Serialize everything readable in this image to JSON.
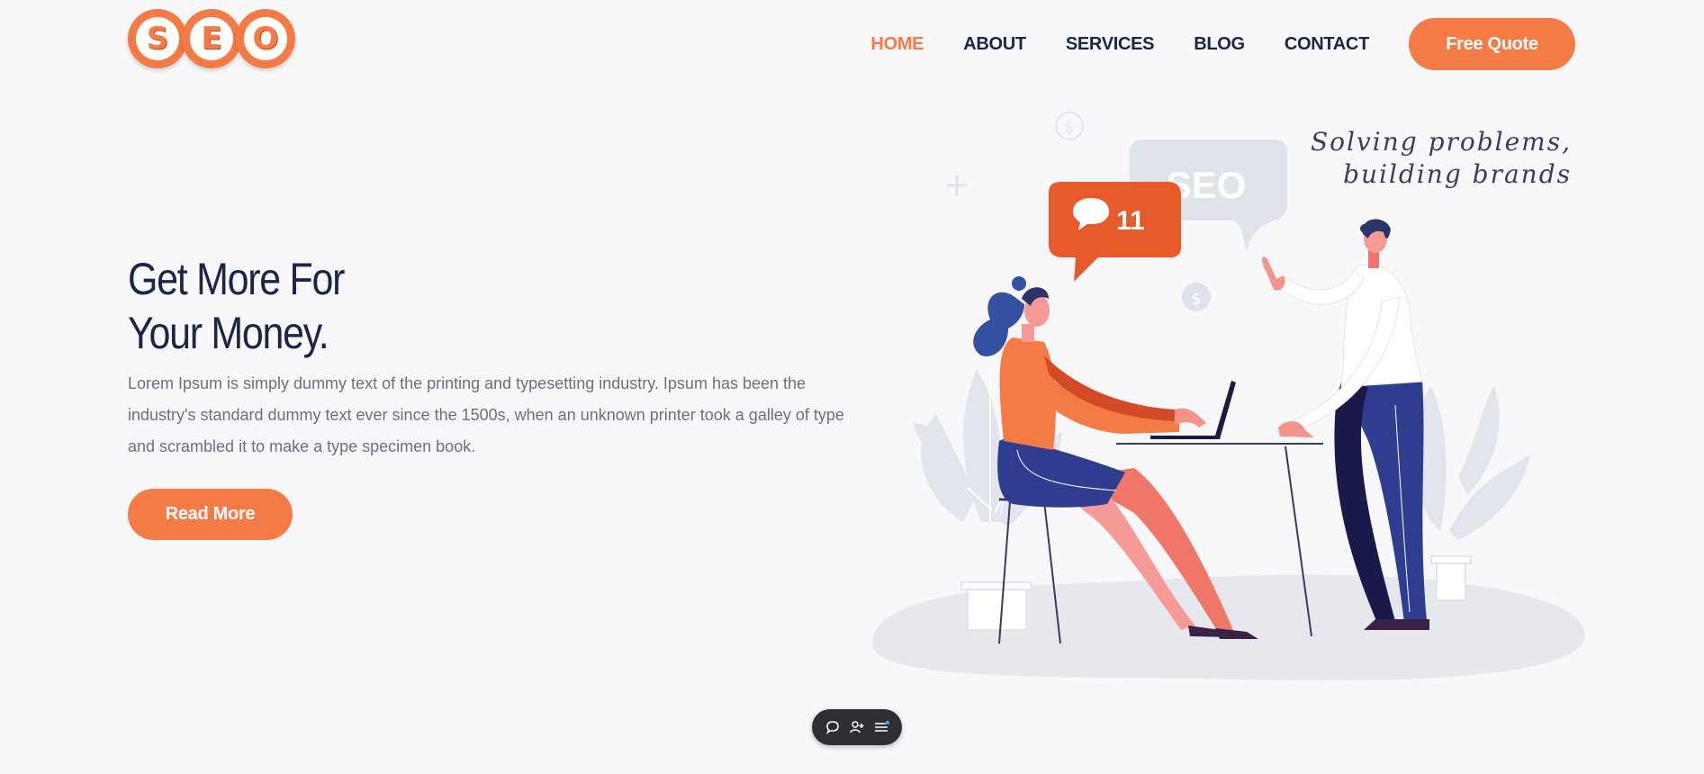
{
  "logo": {
    "letters": [
      "S",
      "E",
      "O"
    ]
  },
  "nav": {
    "items": [
      {
        "label": "HOME",
        "active": true
      },
      {
        "label": "ABOUT",
        "active": false
      },
      {
        "label": "SERVICES",
        "active": false
      },
      {
        "label": "BLOG",
        "active": false
      },
      {
        "label": "CONTACT",
        "active": false
      }
    ],
    "cta_label": "Free Quote"
  },
  "hero": {
    "title_line1": "Get More For",
    "title_line2": "Your Money.",
    "body": "Lorem Ipsum is simply dummy text of the printing and typesetting industry. Ipsum has been the industry's standard dummy text ever since the 1500s, when an unknown printer took a galley of type and scrambled it to make a type specimen book.",
    "button_label": "Read More"
  },
  "illustration": {
    "tagline_line1": "Solving problems,",
    "tagline_line2": "building brands",
    "bubble_seo": "SEO",
    "bubble_count": "11",
    "dollar_glyph": "$"
  },
  "toolbar": {
    "icons": [
      "comment-icon",
      "add-user-icon",
      "menu-icon"
    ]
  },
  "colors": {
    "accent": "#f47b45",
    "navy": "#1d2547",
    "text_muted": "#6b6f80",
    "background": "#f8f8fb"
  }
}
